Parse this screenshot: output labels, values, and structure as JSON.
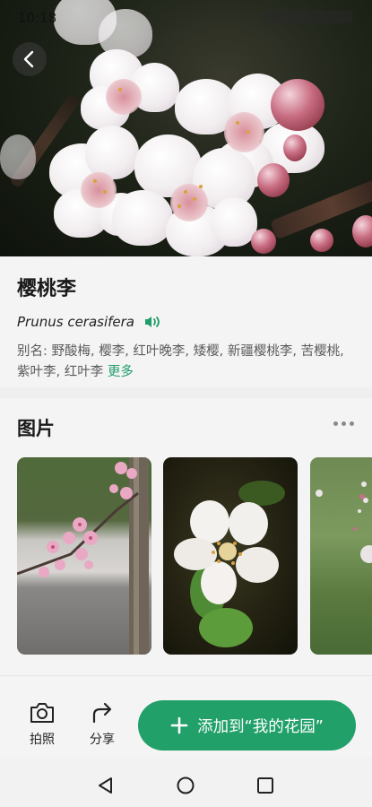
{
  "status": {
    "time": "10:18"
  },
  "plant": {
    "name": "樱桃李",
    "latin": "Prunus cerasifera",
    "alias": "别名: 野酸梅, 樱李, 红叶晚李, 矮樱, 新疆樱桃李, 苦樱桃, 紫叶李, 红叶李",
    "more": "更多"
  },
  "gallery": {
    "title": "图片",
    "count_shown": 3
  },
  "actions": {
    "photo": "拍照",
    "share": "分享",
    "add": "添加到“我的花园”"
  },
  "colors": {
    "accent": "#21a06a",
    "more_link": "#1f9d6a"
  },
  "icons": [
    "back-icon",
    "speaker-icon",
    "more-dots-icon",
    "camera-icon",
    "share-icon",
    "plus-icon",
    "nav-back-icon",
    "nav-home-icon",
    "nav-recents-icon"
  ]
}
